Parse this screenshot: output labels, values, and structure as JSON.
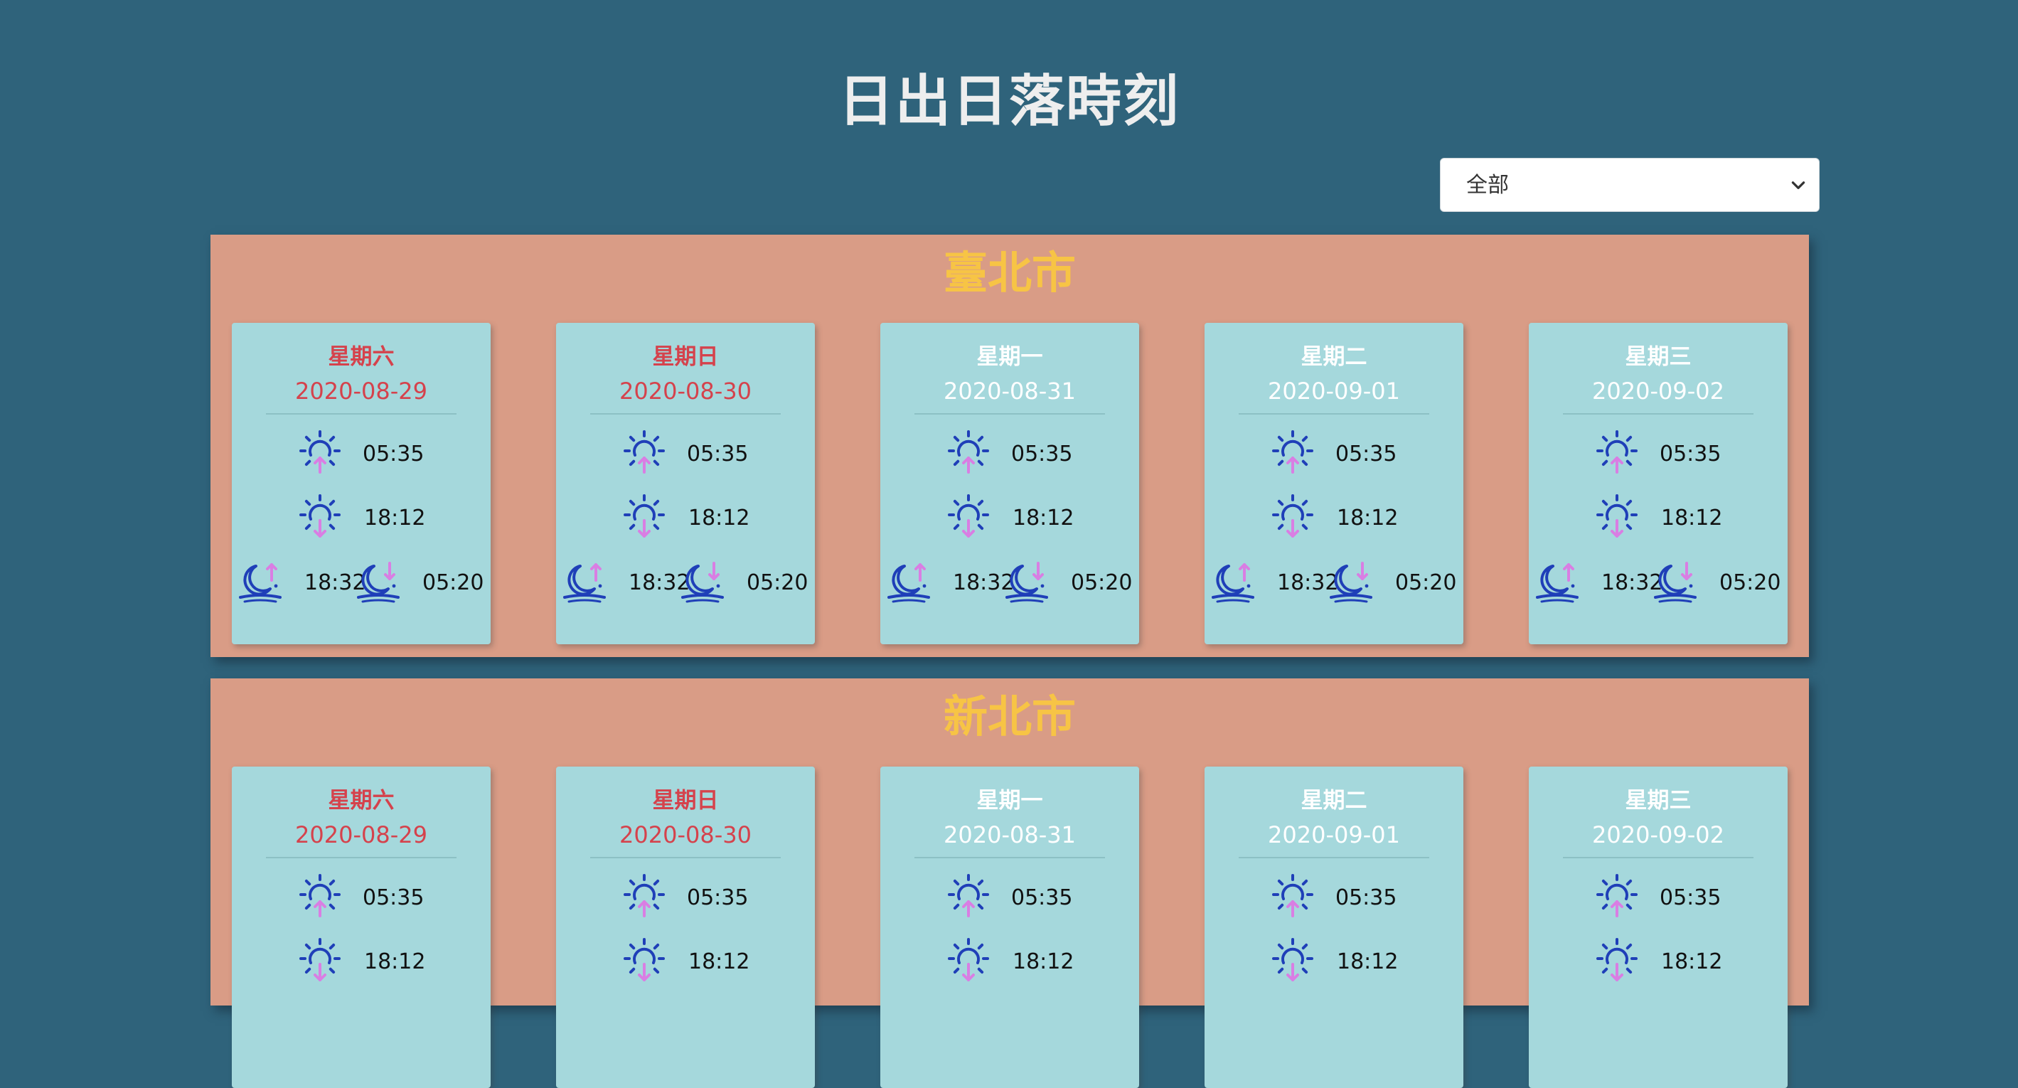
{
  "header": {
    "title": "日出日落時刻"
  },
  "filter": {
    "selected": "全部"
  },
  "colors": {
    "background": "#2f637b",
    "section": "#d99c86",
    "card": "#a5d8dc",
    "city_title": "#f7c445",
    "weekend_text": "#d5424c",
    "weekday_text": "#ffffff",
    "icon_primary": "#1f3fb8",
    "icon_arrow": "#d97ee3"
  },
  "icons": {
    "sunrise": "sunrise-icon",
    "sunset": "sunset-icon",
    "moonrise": "moonrise-icon",
    "moonset": "moonset-icon"
  },
  "cities": [
    {
      "name": "臺北市",
      "days": [
        {
          "weekday": "星期六",
          "date": "2020-08-29",
          "weekend": true,
          "sunrise": "05:35",
          "sunset": "18:12",
          "moonrise": "18:32",
          "moonset": "05:20"
        },
        {
          "weekday": "星期日",
          "date": "2020-08-30",
          "weekend": true,
          "sunrise": "05:35",
          "sunset": "18:12",
          "moonrise": "18:32",
          "moonset": "05:20"
        },
        {
          "weekday": "星期一",
          "date": "2020-08-31",
          "weekend": false,
          "sunrise": "05:35",
          "sunset": "18:12",
          "moonrise": "18:32",
          "moonset": "05:20"
        },
        {
          "weekday": "星期二",
          "date": "2020-09-01",
          "weekend": false,
          "sunrise": "05:35",
          "sunset": "18:12",
          "moonrise": "18:32",
          "moonset": "05:20"
        },
        {
          "weekday": "星期三",
          "date": "2020-09-02",
          "weekend": false,
          "sunrise": "05:35",
          "sunset": "18:12",
          "moonrise": "18:32",
          "moonset": "05:20"
        }
      ]
    },
    {
      "name": "新北市",
      "days": [
        {
          "weekday": "星期六",
          "date": "2020-08-29",
          "weekend": true,
          "sunrise": "05:35",
          "sunset": "18:12"
        },
        {
          "weekday": "星期日",
          "date": "2020-08-30",
          "weekend": true,
          "sunrise": "05:35",
          "sunset": "18:12"
        },
        {
          "weekday": "星期一",
          "date": "2020-08-31",
          "weekend": false,
          "sunrise": "05:35",
          "sunset": "18:12"
        },
        {
          "weekday": "星期二",
          "date": "2020-09-01",
          "weekend": false,
          "sunrise": "05:35",
          "sunset": "18:12"
        },
        {
          "weekday": "星期三",
          "date": "2020-09-02",
          "weekend": false,
          "sunrise": "05:35",
          "sunset": "18:12"
        }
      ]
    }
  ]
}
